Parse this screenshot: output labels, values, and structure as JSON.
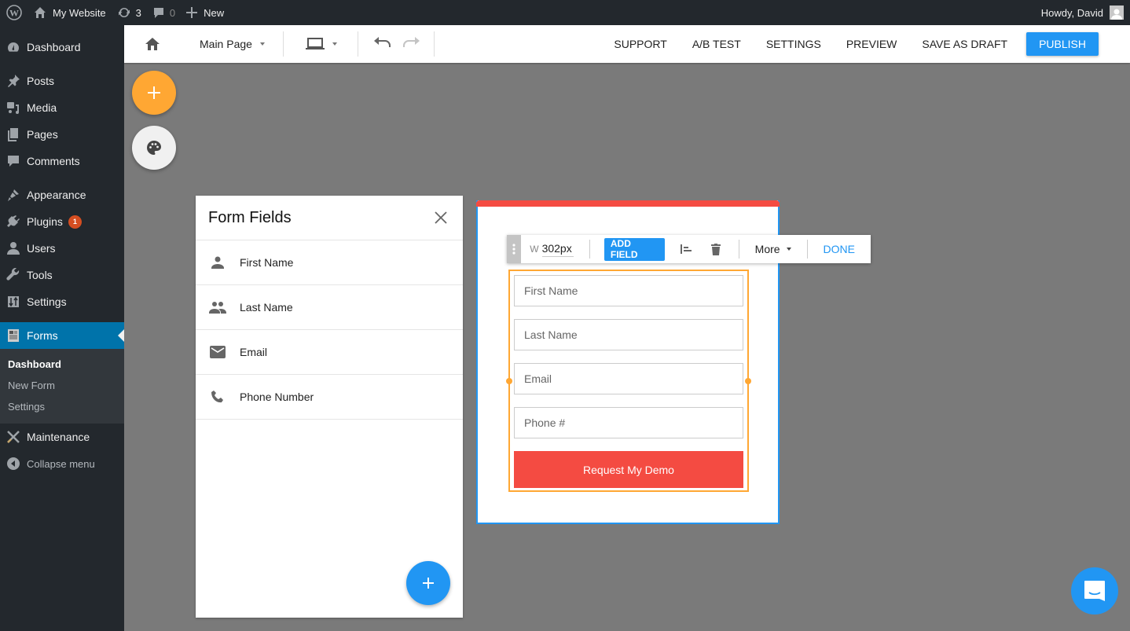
{
  "adminbar": {
    "site_name": "My Website",
    "updates_count": "3",
    "comments_count": "0",
    "new_label": "New",
    "greeting": "Howdy, David"
  },
  "sidebar": {
    "items": [
      {
        "label": "Dashboard",
        "icon": "dashboard-icon"
      },
      {
        "label": "Posts",
        "icon": "pin-icon"
      },
      {
        "label": "Media",
        "icon": "media-icon"
      },
      {
        "label": "Pages",
        "icon": "pages-icon"
      },
      {
        "label": "Comments",
        "icon": "comment-icon"
      },
      {
        "label": "Appearance",
        "icon": "paintbrush-icon"
      },
      {
        "label": "Plugins",
        "icon": "plugin-icon",
        "badge": "1"
      },
      {
        "label": "Users",
        "icon": "user-icon"
      },
      {
        "label": "Tools",
        "icon": "wrench-icon"
      },
      {
        "label": "Settings",
        "icon": "settings-icon"
      },
      {
        "label": "Forms",
        "icon": "forms-icon",
        "active": true
      },
      {
        "label": "Maintenance",
        "icon": "maintenance-icon"
      },
      {
        "label": "Collapse menu",
        "icon": "collapse-icon"
      }
    ],
    "submenu": [
      {
        "label": "Dashboard",
        "current": true
      },
      {
        "label": "New Form"
      },
      {
        "label": "Settings"
      }
    ]
  },
  "toolbar": {
    "page_select": "Main Page",
    "actions": [
      "SUPPORT",
      "A/B TEST",
      "SETTINGS",
      "PREVIEW",
      "SAVE AS DRAFT"
    ],
    "publish_label": "PUBLISH"
  },
  "panel": {
    "title": "Form Fields",
    "items": [
      {
        "label": "First Name",
        "icon": "person-icon"
      },
      {
        "label": "Last Name",
        "icon": "people-icon"
      },
      {
        "label": "Email",
        "icon": "email-icon"
      },
      {
        "label": "Phone Number",
        "icon": "phone-icon"
      }
    ]
  },
  "block_toolbar": {
    "width_label": "W",
    "width_value": "302px",
    "add_field_label": "ADD FIELD",
    "more_label": "More",
    "done_label": "DONE"
  },
  "form": {
    "fields": [
      {
        "placeholder": "First Name"
      },
      {
        "placeholder": "Last Name"
      },
      {
        "placeholder": "Email"
      },
      {
        "placeholder": "Phone #"
      }
    ],
    "submit_label": "Request My Demo"
  },
  "colors": {
    "accent": "#2196f3",
    "fab_orange": "#ffa733",
    "submit_red": "#f44b42",
    "wp_active": "#0073aa",
    "wp_dark": "#23282d"
  }
}
